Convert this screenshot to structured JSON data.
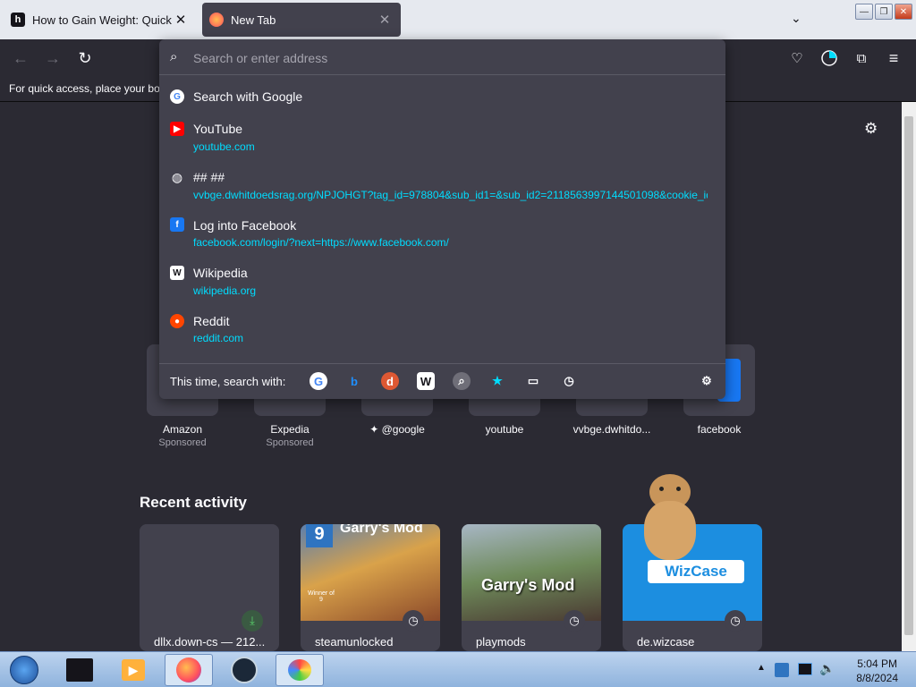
{
  "tabs": [
    {
      "title": "How to Gain Weight: Quick, Saf",
      "favicon": "h"
    },
    {
      "title": "New Tab",
      "favicon": "firefox-icon"
    }
  ],
  "nav": {
    "bookmarks_hint": "For quick access, place your boo"
  },
  "urlbar": {
    "placeholder": "Search or enter address"
  },
  "suggestions": [
    {
      "title": "Search with Google",
      "url": "",
      "icon": "google-icon"
    },
    {
      "title": "YouTube",
      "url": "youtube.com",
      "icon": "youtube-icon"
    },
    {
      "title": "## ##",
      "url": "vvbge.dwhitdoedsrag.org/NPJOHGT?tag_id=978804&sub_id1=&sub_id2=2118563997144501098&cookie_id=",
      "icon": "globe-icon"
    },
    {
      "title": "Log into Facebook",
      "url": "facebook.com/login/?next=https://www.facebook.com/",
      "icon": "facebook-icon"
    },
    {
      "title": "Wikipedia",
      "url": "wikipedia.org",
      "icon": "wikipedia-icon"
    },
    {
      "title": "Reddit",
      "url": "reddit.com",
      "icon": "reddit-icon"
    }
  ],
  "search_with": {
    "label": "This time, search with:"
  },
  "shortcuts": [
    {
      "name": "Amazon",
      "sub": "Sponsored"
    },
    {
      "name": "Expedia",
      "sub": "Sponsored"
    },
    {
      "name": "@google",
      "sub": ""
    },
    {
      "name": "youtube",
      "sub": ""
    },
    {
      "name": "vvbge.dwhitdo...",
      "sub": ""
    },
    {
      "name": "facebook",
      "sub": ""
    }
  ],
  "recent": {
    "heading": "Recent activity",
    "cards": [
      {
        "label": "dllx.down-cs — 212..."
      },
      {
        "label": "steamunlocked"
      },
      {
        "label": "playmods"
      },
      {
        "label": "de.wizcase"
      }
    ]
  },
  "card_texts": {
    "gmod1": "Garry's Mod",
    "gmod2": "Garry's Mod",
    "wizcase": "WizCase",
    "winner": "Winner of 9"
  },
  "taskbar": {
    "time": "5:04 PM",
    "date": "8/8/2024"
  },
  "colors": {
    "accent": "#00ddff",
    "panel": "#42414d",
    "toolbar": "#2b2a33"
  }
}
